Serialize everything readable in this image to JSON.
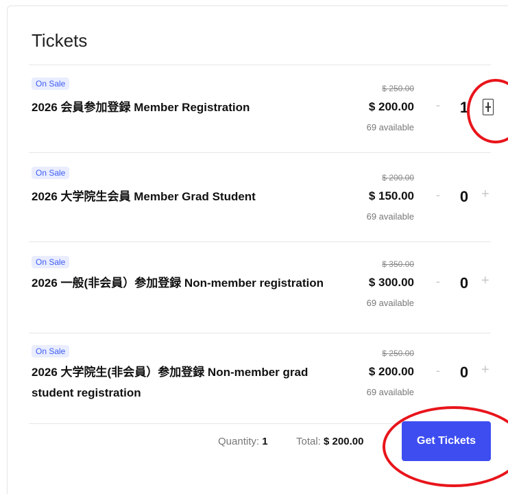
{
  "header": {
    "title": "Tickets"
  },
  "tickets": [
    {
      "badge": "On Sale",
      "name": "2026 会員参加登録 Member Registration",
      "old_price": "$ 250.00",
      "price": "$ 200.00",
      "availability": "69 available",
      "quantity": "1",
      "minus_symbol": "-",
      "plus_symbol": "+"
    },
    {
      "badge": "On Sale",
      "name": "2026 大学院生会員 Member Grad Student",
      "old_price": "$ 200.00",
      "price": "$ 150.00",
      "availability": "69 available",
      "quantity": "0",
      "minus_symbol": "-",
      "plus_symbol": "+"
    },
    {
      "badge": "On Sale",
      "name": "2026 一般(非会員）参加登録 Non-member registration",
      "old_price": "$ 350.00",
      "price": "$ 300.00",
      "availability": "69 available",
      "quantity": "0",
      "minus_symbol": "-",
      "plus_symbol": "+"
    },
    {
      "badge": "On Sale",
      "name": "2026 大学院生(非会員）参加登録 Non-member grad student registration",
      "old_price": "$ 250.00",
      "price": "$ 200.00",
      "availability": "69 available",
      "quantity": "0",
      "minus_symbol": "-",
      "plus_symbol": "+"
    }
  ],
  "footer": {
    "quantity_label": "Quantity:",
    "quantity_value": "1",
    "total_label": "Total:",
    "total_value": "$ 200.00",
    "button_label": "Get Tickets"
  },
  "colors": {
    "accent": "#3d4df0",
    "badge_bg": "#e9edff",
    "badge_text": "#3d5cf5",
    "annotation_ring": "#e8151b"
  },
  "icons": {
    "minus": "minus-icon",
    "plus": "plus-icon"
  }
}
